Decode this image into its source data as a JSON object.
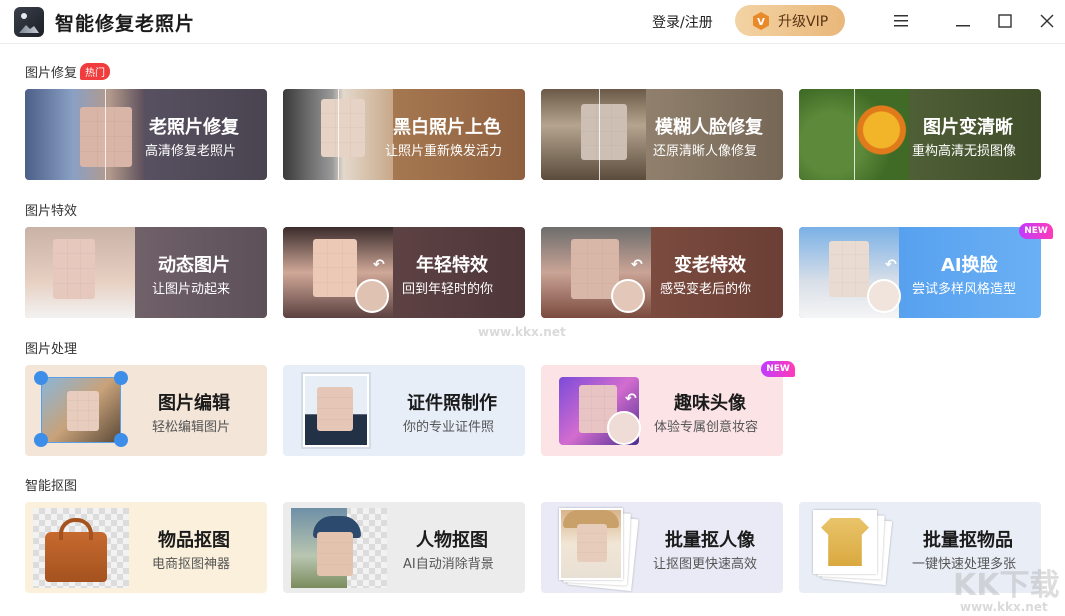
{
  "app": {
    "title": "智能修复老照片",
    "login": "登录/注册",
    "vip": "升级VIP"
  },
  "sections": [
    {
      "title": "图片修复",
      "tag": "热门"
    },
    {
      "title": "图片特效"
    },
    {
      "title": "图片处理"
    },
    {
      "title": "智能抠图"
    }
  ],
  "repair": [
    {
      "title": "老照片修复",
      "sub": "高清修复老照片"
    },
    {
      "title": "黑白照片上色",
      "sub": "让照片重新焕发活力"
    },
    {
      "title": "模糊人脸修复",
      "sub": "还原清晰人像修复"
    },
    {
      "title": "图片变清晰",
      "sub": "重构高清无损图像"
    }
  ],
  "effects": [
    {
      "title": "动态图片",
      "sub": "让图片动起来"
    },
    {
      "title": "年轻特效",
      "sub": "回到年轻时的你"
    },
    {
      "title": "变老特效",
      "sub": "感受变老后的你"
    },
    {
      "title": "AI换脸",
      "sub": "尝试多样风格造型",
      "tag": "NEW"
    }
  ],
  "process": [
    {
      "title": "图片编辑",
      "sub": "轻松编辑图片"
    },
    {
      "title": "证件照制作",
      "sub": "你的专业证件照"
    },
    {
      "title": "趣味头像",
      "sub": "体验专属创意妆容",
      "tag": "NEW"
    }
  ],
  "cutout": [
    {
      "title": "物品抠图",
      "sub": "电商抠图神器"
    },
    {
      "title": "人物抠图",
      "sub": "AI自动消除背景"
    },
    {
      "title": "批量抠人像",
      "sub": "让抠图更快速高效"
    },
    {
      "title": "批量抠物品",
      "sub": "一键快速处理多张"
    }
  ],
  "watermark": {
    "mid": "www.kkx.net",
    "logo": "KK下载",
    "bottom": "www.kkx.net"
  }
}
